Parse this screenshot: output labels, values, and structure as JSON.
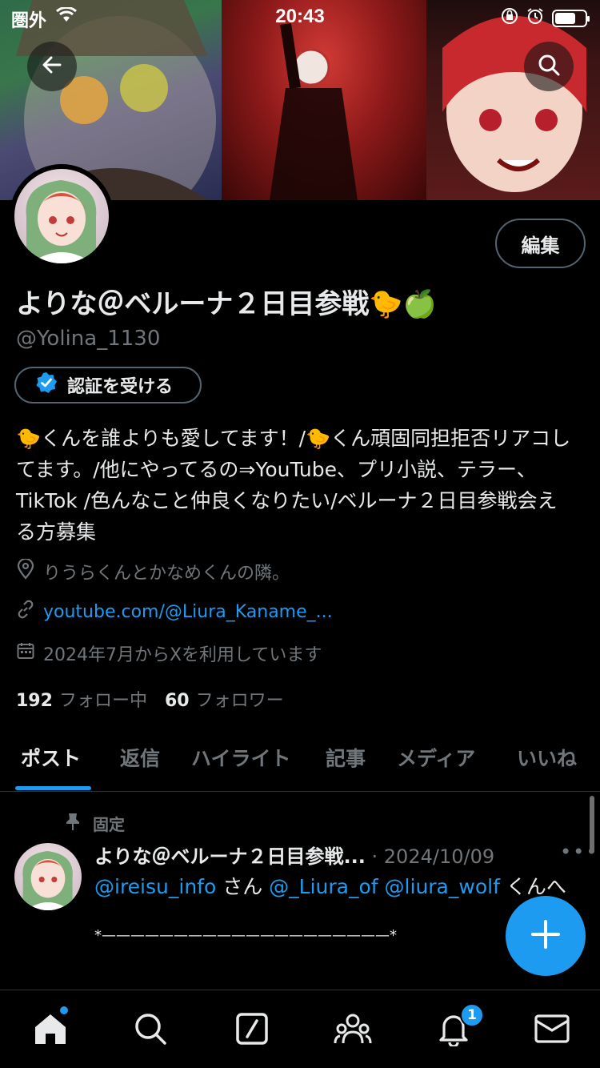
{
  "status_bar": {
    "carrier": "圏外",
    "time": "20:43",
    "battery_level": 0.7
  },
  "profile": {
    "name": "よりな＠ベルーナ２日目参戦🐤🍏",
    "handle": "@Yolina_1130",
    "edit_label": "編集",
    "verify_label": "認証を受ける",
    "bio": "🐤くんを誰よりも愛してます！/🐤くん頑固同担拒否リアコしてます。/他にやってるの⇒YouTube、プリ小説、テラー、TikTok /色んなこと仲良くなりたい/ベルーナ２日目参戦会える方募集",
    "location": "りうらくんとかなめくんの隣。",
    "link": "youtube.com/@Liura_Kaname_...",
    "joined": "2024年7月からXを利用しています",
    "following_count": "192",
    "following_label": "フォロー中",
    "followers_count": "60",
    "followers_label": "フォロワー"
  },
  "tabs": [
    {
      "label": "ポスト",
      "active": true
    },
    {
      "label": "返信",
      "active": false
    },
    {
      "label": "ハイライト",
      "active": false
    },
    {
      "label": "記事",
      "active": false
    },
    {
      "label": "メディア",
      "active": false
    },
    {
      "label": "いいね",
      "active": false
    }
  ],
  "pinned_post": {
    "pinned_label": "固定",
    "author": "よりな＠ベルーナ２日目参戦...",
    "date": "· 2024/10/09",
    "mention1": "@ireisu_info",
    "text1": " さん ",
    "mention2": "@_Liura_of",
    "space": " ",
    "mention3": "@liura_wolf",
    "text2": " くんへ",
    "divider": "*————————————————————*"
  },
  "icons": {
    "back": "arrow-left-icon",
    "search": "search-icon",
    "verified": "verified-badge-icon",
    "location": "location-pin-icon",
    "link": "link-icon",
    "calendar": "calendar-icon",
    "pin": "pin-icon",
    "compose": "plus-icon"
  },
  "nav": {
    "notifications_badge": "1"
  },
  "colors": {
    "accent": "#1d9bf0",
    "background": "#000000",
    "secondary_text": "#71767b"
  }
}
